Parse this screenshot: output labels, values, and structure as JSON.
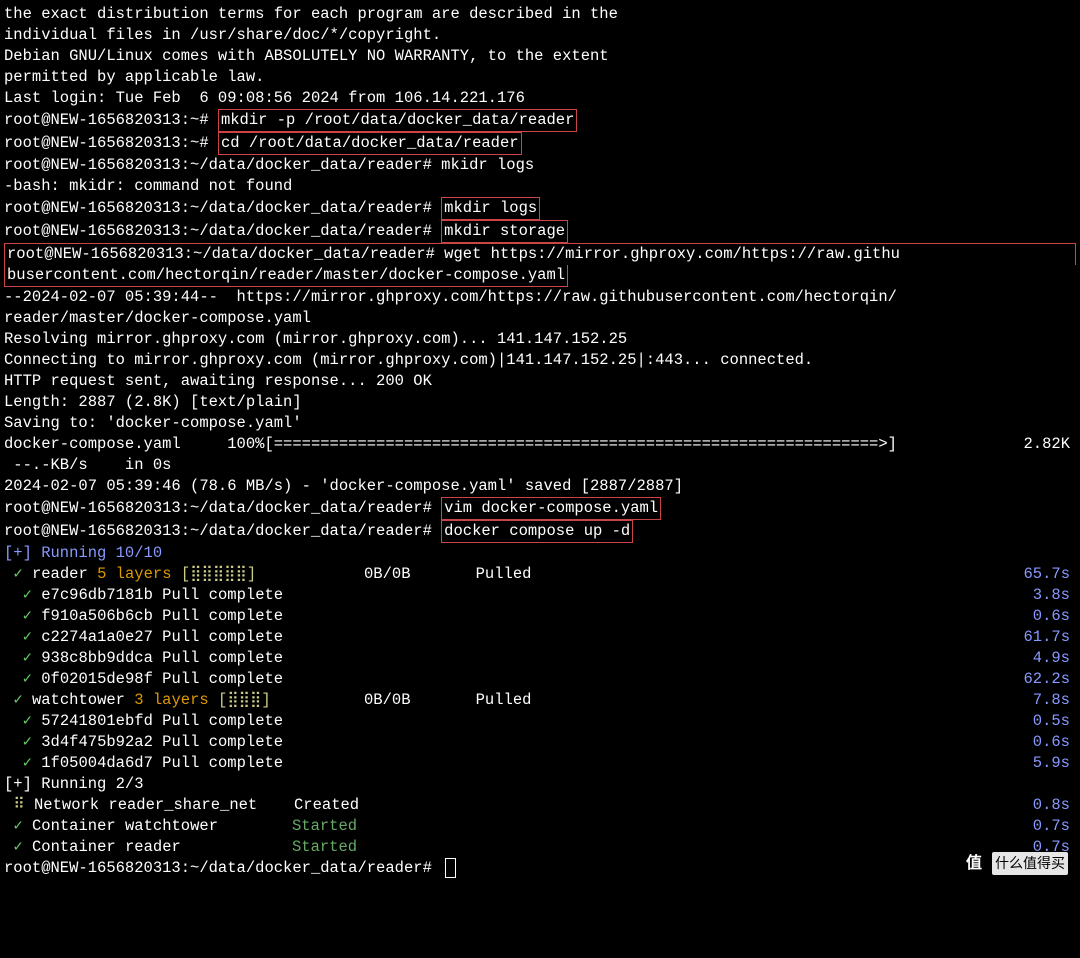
{
  "intro": {
    "l1": "the exact distribution terms for each program are described in the",
    "l2": "individual files in /usr/share/doc/*/copyright.",
    "l3": "",
    "l4": "Debian GNU/Linux comes with ABSOLUTELY NO WARRANTY, to the extent",
    "l5": "permitted by applicable law.",
    "l6": "Last login: Tue Feb  6 09:08:56 2024 from 106.14.221.176"
  },
  "prompts": {
    "home": "root@NEW-1656820313:~#",
    "reader": "root@NEW-1656820313:~/data/docker_data/reader#"
  },
  "cmds": {
    "mkdir_p": "mkdir -p /root/data/docker_data/reader",
    "cd": "cd /root/data/docker_data/reader",
    "mkidr": "mkidr logs",
    "bash_err": "-bash: mkidr: command not found",
    "mkdir_logs": "mkdir logs",
    "mkdir_storage": "mkdir storage",
    "wget": "wget https://mirror.ghproxy.com/https://raw.githu",
    "wget2": "busercontent.com/hectorqin/reader/master/docker-compose.yaml",
    "vim": "vim docker-compose.yaml",
    "dcu": "docker compose up -d"
  },
  "wget_out": {
    "l1": "--2024-02-07 05:39:44--  https://mirror.ghproxy.com/https://raw.githubusercontent.com/hectorqin/",
    "l2": "reader/master/docker-compose.yaml",
    "l3": "Resolving mirror.ghproxy.com (mirror.ghproxy.com)... 141.147.152.25",
    "l4": "Connecting to mirror.ghproxy.com (mirror.ghproxy.com)|141.147.152.25|:443... connected.",
    "l5": "HTTP request sent, awaiting response... 200 OK",
    "l6": "Length: 2887 (2.8K) [text/plain]",
    "l7": "Saving to: 'docker-compose.yaml'",
    "l8": "",
    "prog_name": "docker-compose.yaml",
    "prog_pct": "100%",
    "prog_bar": "[=================================================================>]",
    "prog_size": "2.82K",
    "prog_speed": " --.-KB/s    in 0s",
    "l9": "",
    "done": "2024-02-07 05:39:46 (78.6 MB/s) - 'docker-compose.yaml' saved [2887/2887]",
    "l10": ""
  },
  "running1": "Running 10/10",
  "pulls": [
    {
      "name": "reader",
      "layers": "5 layers",
      "bar": "[⣿⣿⣿⣿⣿]",
      "size": "0B/0B",
      "status": "Pulled",
      "time": "65.7s",
      "indent": 1
    },
    {
      "name": "e7c96db7181b",
      "status": "Pull complete",
      "time": "3.8s",
      "indent": 2
    },
    {
      "name": "f910a506b6cb",
      "status": "Pull complete",
      "time": "0.6s",
      "indent": 2
    },
    {
      "name": "c2274a1a0e27",
      "status": "Pull complete",
      "time": "61.7s",
      "indent": 2
    },
    {
      "name": "938c8bb9ddca",
      "status": "Pull complete",
      "time": "4.9s",
      "indent": 2
    },
    {
      "name": "0f02015de98f",
      "status": "Pull complete",
      "time": "62.2s",
      "indent": 2
    },
    {
      "name": "watchtower",
      "layers": "3 layers",
      "bar": "[⣿⣿⣿]",
      "size": "0B/0B",
      "status": "Pulled",
      "time": "7.8s",
      "indent": 1
    },
    {
      "name": "57241801ebfd",
      "status": "Pull complete",
      "time": "0.5s",
      "indent": 2
    },
    {
      "name": "3d4f475b92a2",
      "status": "Pull complete",
      "time": "0.6s",
      "indent": 2
    },
    {
      "name": "1f05004da6d7",
      "status": "Pull complete",
      "time": "5.9s",
      "indent": 2
    }
  ],
  "running2": "Running 2/3",
  "containers": [
    {
      "marker": "⠿",
      "marker_color": "yellow",
      "name": "Network reader_share_net",
      "status": "Created",
      "status_color": "dim",
      "time": "0.8s"
    },
    {
      "marker": "✓",
      "marker_color": "check",
      "name": "Container watchtower",
      "status": "Started",
      "status_color": "green-dim",
      "time": "0.7s"
    },
    {
      "marker": "✓",
      "marker_color": "check",
      "name": "Container reader",
      "status": "Started",
      "status_color": "green-dim",
      "time": "0.7s"
    }
  ],
  "badge": {
    "symbol": "值",
    "text": "什么值得买"
  }
}
